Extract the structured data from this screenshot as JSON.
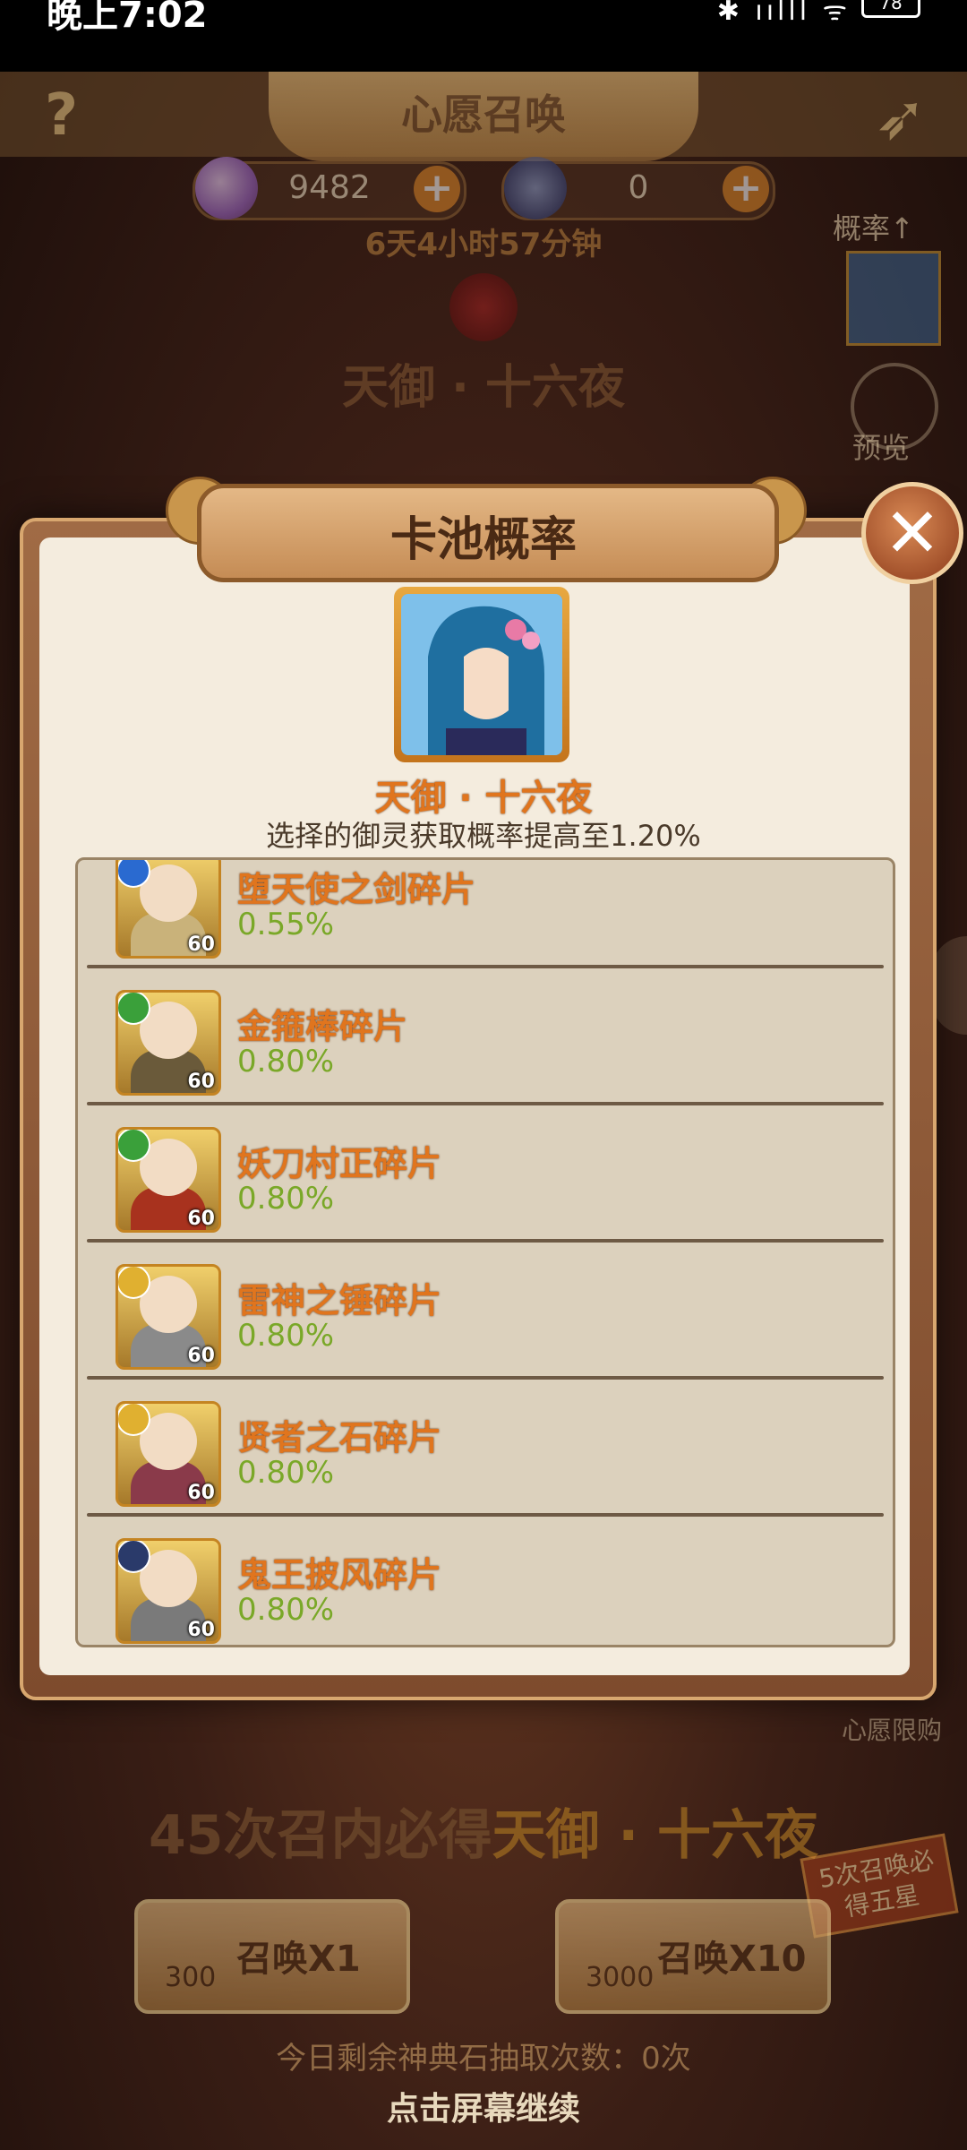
{
  "status_bar": {
    "time": "晚上7:02",
    "battery": "78"
  },
  "header": {
    "title": "心愿召唤",
    "help_label": "?"
  },
  "currencies": [
    {
      "value": "9482",
      "plus": "+"
    },
    {
      "value": "0",
      "plus": "+"
    }
  ],
  "countdown": "6天4小时57分钟",
  "featured_hero_bg": "天御 · 十六夜",
  "side": {
    "rate_label": "概率↑",
    "preview_label": "预览",
    "wish_shop": "心愿限购"
  },
  "modal": {
    "title": "卡池概率",
    "close_label": "✕",
    "featured_name": "天御 · 十六夜",
    "rate_boost": "选择的御灵获取概率提高至1.20%",
    "items": [
      {
        "name": "堕天使之剑碎片",
        "rate": "0.55%",
        "level": "60",
        "badge_color": "#2a6ad0",
        "body_color": "#c9b27a"
      },
      {
        "name": "金箍棒碎片",
        "rate": "0.80%",
        "level": "60",
        "badge_color": "#3aa03a",
        "body_color": "#6a5a3a"
      },
      {
        "name": "妖刀村正碎片",
        "rate": "0.80%",
        "level": "60",
        "badge_color": "#3aa03a",
        "body_color": "#a8321e"
      },
      {
        "name": "雷神之锤碎片",
        "rate": "0.80%",
        "level": "60",
        "badge_color": "#e0b030",
        "body_color": "#8a8a8a"
      },
      {
        "name": "贤者之石碎片",
        "rate": "0.80%",
        "level": "60",
        "badge_color": "#e0b030",
        "body_color": "#8a3a4a"
      },
      {
        "name": "鬼王披风碎片",
        "rate": "0.80%",
        "level": "60",
        "badge_color": "#2a3a6a",
        "body_color": "#7a7a7a"
      }
    ]
  },
  "bottom": {
    "guarantee_prefix": "45次召内必得",
    "guarantee_hero": "天御 · 十六夜",
    "five_star": "5次召唤必得五星",
    "summon_1": {
      "cost": "300",
      "label": "召唤X1"
    },
    "summon_10": {
      "cost": "3000",
      "label": "召唤X10"
    },
    "remaining": "今日剩余神典石抽取次数：0次",
    "tap_continue": "点击屏幕继续"
  }
}
